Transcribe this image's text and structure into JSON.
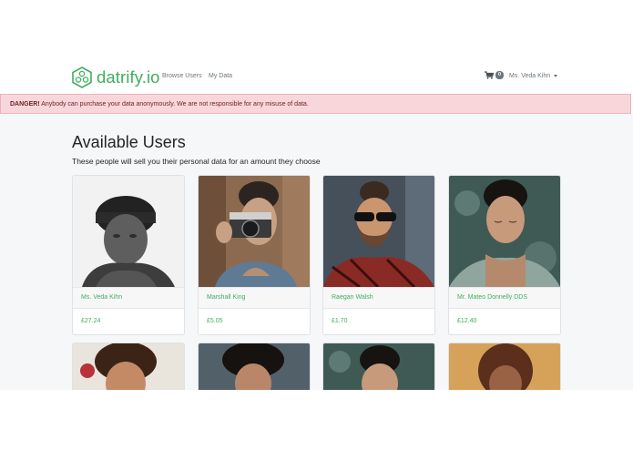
{
  "brand": {
    "name": "datrify.io"
  },
  "nav": {
    "browse_users": "Browse Users",
    "my_data": "My Data"
  },
  "cart": {
    "count": "0"
  },
  "user_menu": {
    "label": "Ms. Veda Kihn"
  },
  "alert": {
    "title": "DANGER!",
    "message": "Anybody can purchase your data anonymously. We are not responsible for any misuse of data."
  },
  "page": {
    "title": "Available Users",
    "subtitle": "These people will sell you their personal data for an amount they choose"
  },
  "users": [
    {
      "name": "Ms. Veda Kihn",
      "price": "£27.24"
    },
    {
      "name": "Marshall King",
      "price": "£5.05"
    },
    {
      "name": "Raegan Walsh",
      "price": "£1.70"
    },
    {
      "name": "Mr. Mateo Donnelly DDS",
      "price": "£12.40"
    }
  ],
  "colors": {
    "brand_green": "#3fae5e",
    "danger_bg": "#f8d7da",
    "danger_text": "#721c24"
  }
}
